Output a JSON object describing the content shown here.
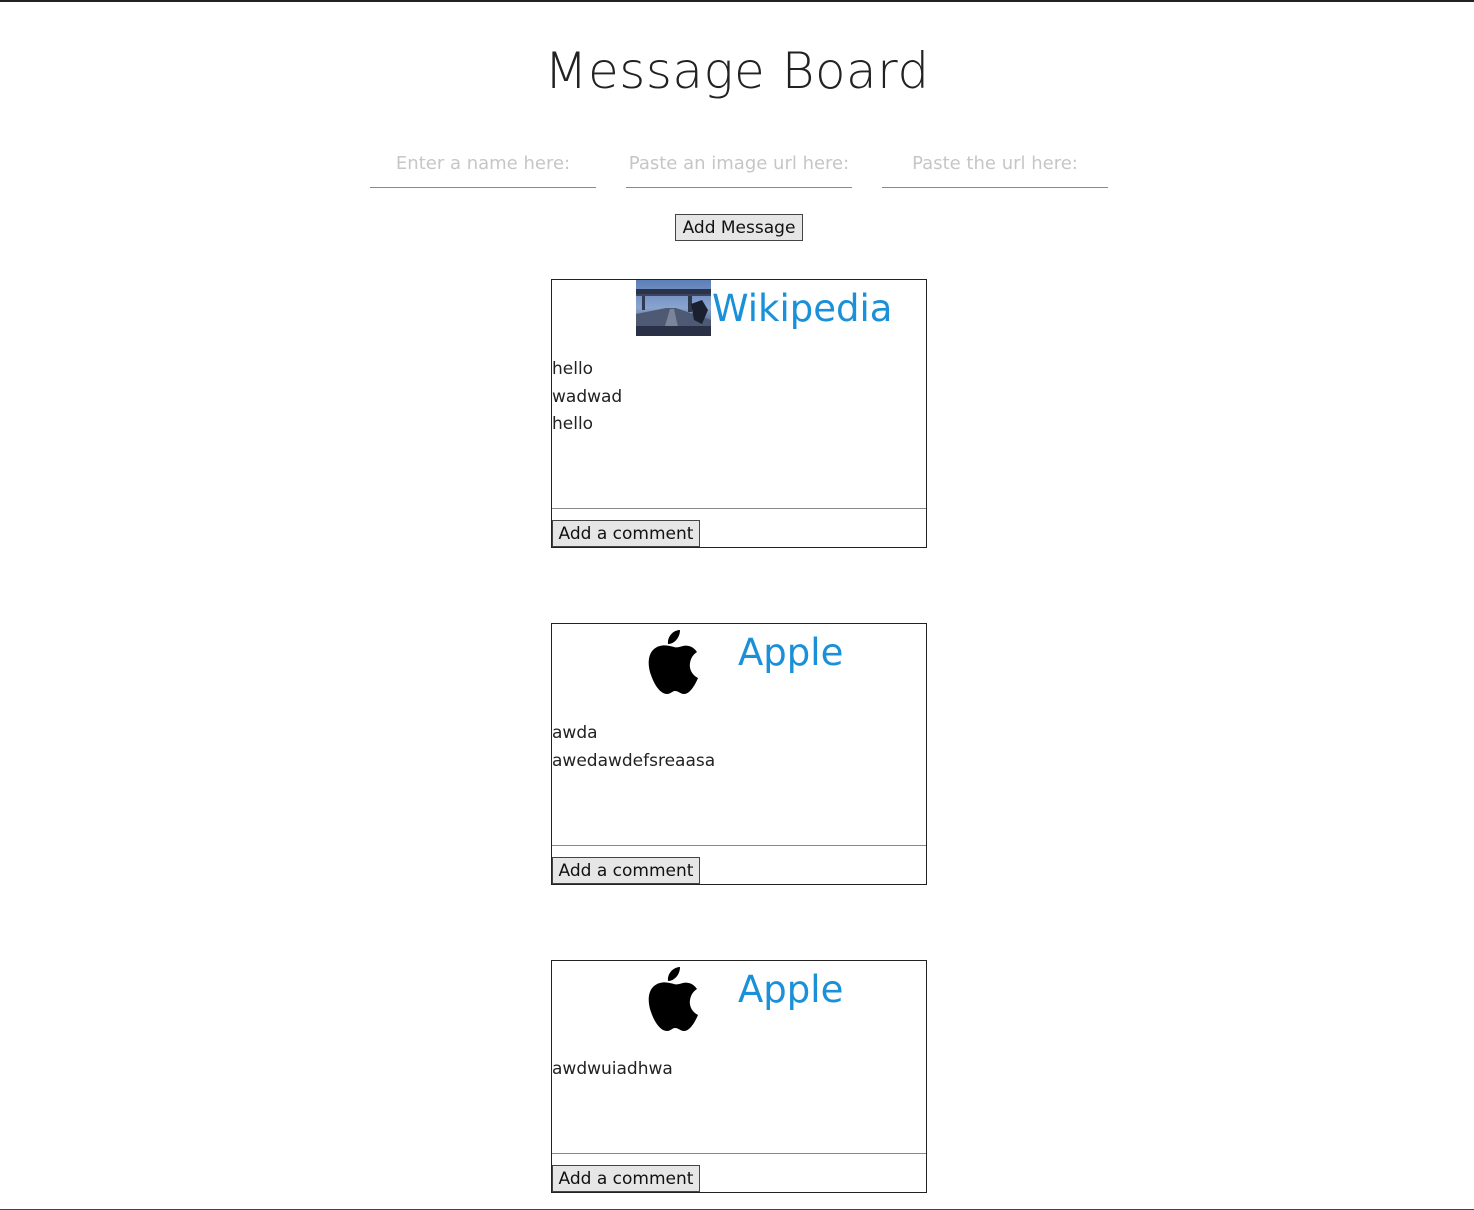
{
  "page": {
    "title": "Message Board"
  },
  "form": {
    "name_placeholder": "Enter a name here:",
    "image_placeholder": "Paste an image url here:",
    "url_placeholder": "Paste the url here:",
    "add_message_label": "Add Message"
  },
  "messages": [
    {
      "title": "Wikipedia",
      "logo": "photo-thumbnail",
      "comments": [
        "hello",
        "wadwad",
        "hello"
      ],
      "add_comment_label": "Add a comment"
    },
    {
      "title": "Apple",
      "logo": "apple-logo",
      "comments": [
        "awda",
        "awedawdefsreaasa"
      ],
      "add_comment_label": "Add a comment"
    },
    {
      "title": "Apple",
      "logo": "apple-logo",
      "comments": [
        "awdwuiadhwa"
      ],
      "add_comment_label": "Add a comment"
    }
  ],
  "colors": {
    "link": "#1a90d8",
    "text": "#222222",
    "button_bg": "#e6e6e6"
  }
}
